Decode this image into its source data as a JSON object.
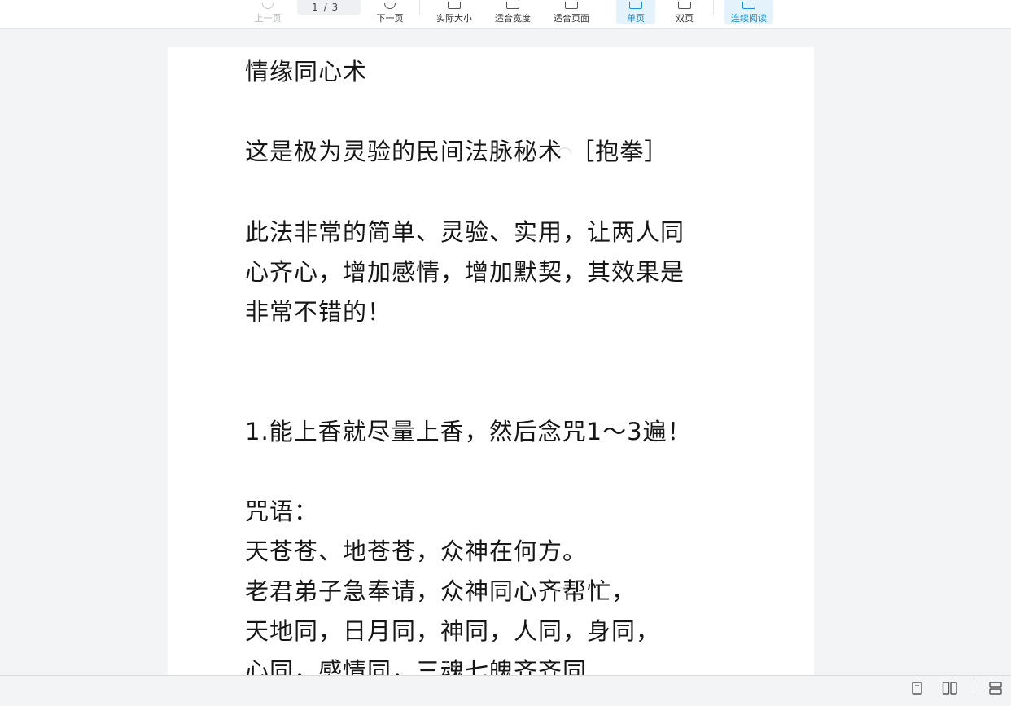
{
  "toolbar": {
    "prev_label": "上一页",
    "page_current": "1",
    "page_total": "/ 3",
    "next_label": "下一页",
    "actual_size_label": "实际大小",
    "fit_width_label": "适合宽度",
    "fit_page_label": "适合页面",
    "single_page_label": "单页",
    "double_page_label": "双页",
    "continuous_label": "连续阅读",
    "accent_color": "#1d8fd0"
  },
  "document": {
    "lines": [
      "情缘同心术",
      "这是极为灵验的民间法脉秘术 ［抱拳］",
      "此法非常的简单、灵验、实用，让两人同",
      "心齐心，增加感情，增加默契，其效果是",
      "非常不错的！",
      "1.能上香就尽量上香，然后念咒1～3遍！",
      "咒语：",
      "天苍苍、地苍苍，众神在何方。",
      "老君弟子急奉请，众神同心齐帮忙，",
      "天地同，日月同，神同，人同，身同，",
      "心同，感情同，三魂七魄齐齐同"
    ]
  },
  "statusbar": {
    "icons": [
      "single-page-icon",
      "double-page-icon",
      "continuous-icon"
    ]
  }
}
